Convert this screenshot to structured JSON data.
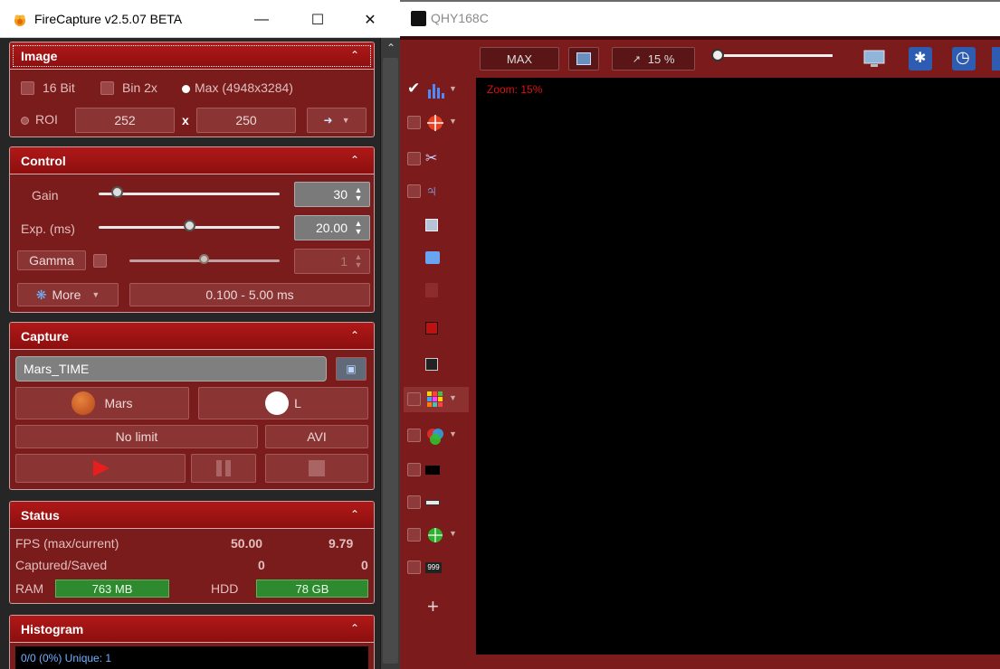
{
  "left_window": {
    "title": "FireCapture v2.5.07 BETA",
    "controls": {
      "minimize": "—",
      "maximize": "☐",
      "close": "✕"
    }
  },
  "image_panel": {
    "title": "Image",
    "bit16_label": "16 Bit",
    "bin2x_label": "Bin 2x",
    "max_label": "Max (4948x3284)",
    "roi_label": "ROI",
    "roi_width": "252",
    "roi_x": "x",
    "roi_height": "250"
  },
  "control_panel": {
    "title": "Control",
    "gain_label": "Gain",
    "gain_value": "30",
    "gain_level": 0.1,
    "exp_label": "Exp. (ms)",
    "exp_value": "20.00",
    "exp_level": 0.5,
    "gamma_label": "Gamma",
    "gamma_value": "1",
    "gamma_level": 0.5,
    "more_label": "More",
    "exposure_range": "0.100 - 5.00 ms"
  },
  "capture_panel": {
    "title": "Capture",
    "filename": "Mars_TIME",
    "planet_label": "Mars",
    "filter_label": "L",
    "limit_label": "No limit",
    "format_label": "AVI"
  },
  "status_panel": {
    "title": "Status",
    "fps_label": "FPS (max/current)",
    "fps_max": "50.00",
    "fps_current": "9.79",
    "captured_label": "Captured/Saved",
    "captured": "0",
    "saved": "0",
    "ram_label": "RAM",
    "ram_value": "763 MB",
    "hdd_label": "HDD",
    "hdd_value": "78 GB"
  },
  "histogram_panel": {
    "title": "Histogram",
    "info": "0/0 (0%)  Unique: 1"
  },
  "right_window": {
    "title": "QHY168C",
    "max_label": "MAX",
    "zoom_label": "15 %",
    "zoom_overlay": "Zoom: 15%",
    "add_label": "+"
  },
  "colors": {
    "panel_bg": "#7a1c1c",
    "panel_head": "#b11818",
    "viewport_bg": "#000000",
    "status_green": "#2e8a2e",
    "zoom_text": "#e01010"
  }
}
